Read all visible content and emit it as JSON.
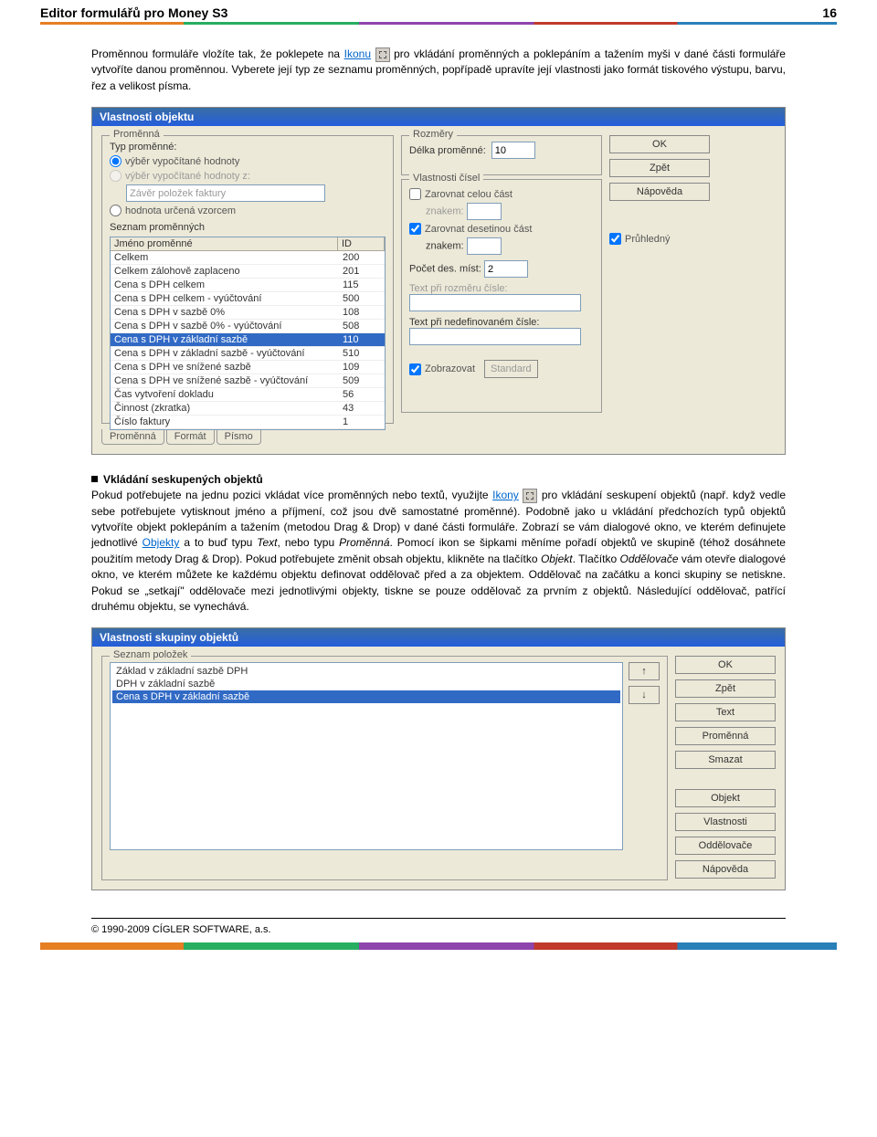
{
  "header": {
    "title": "Editor formulářů pro Money S3",
    "page": "16"
  },
  "para1": {
    "t1": "Proměnnou formuláře vložíte tak, že poklepete na ",
    "link1": "Ikonu",
    "t2": " pro vkládání proměnných a poklepáním a tažením myši v dané části formuláře vytvoříte danou proměnnou. Vyberete její typ ze seznamu proměnných, popřípadě upravíte její vlastnosti jako formát tiskového výstupu, barvu, řez a velikost písma."
  },
  "dlg1": {
    "title": "Vlastnosti objektu",
    "g_promenna": "Proměnná",
    "lbl_typ": "Typ proměnné:",
    "rad1": "výběr vypočítané hodnoty",
    "rad2": "výběr vypočítané hodnoty z:",
    "rad2_val": "Závěr položek faktury",
    "rad3": "hodnota určená vzorcem",
    "lbl_seznam": "Seznam proměnných",
    "th1": "Jméno proměnné",
    "th2": "ID",
    "rows": [
      {
        "n": "Celkem",
        "id": "200"
      },
      {
        "n": "Celkem zálohově zaplaceno",
        "id": "201"
      },
      {
        "n": "Cena s DPH celkem",
        "id": "115"
      },
      {
        "n": "Cena s DPH celkem - vyúčtování",
        "id": "500"
      },
      {
        "n": "Cena s DPH v sazbě 0%",
        "id": "108"
      },
      {
        "n": "Cena s DPH v sazbě 0% - vyúčtování",
        "id": "508"
      },
      {
        "n": "Cena s DPH v základní sazbě",
        "id": "110",
        "sel": true
      },
      {
        "n": "Cena s DPH v základní sazbě - vyúčtování",
        "id": "510"
      },
      {
        "n": "Cena s DPH ve snížené sazbě",
        "id": "109"
      },
      {
        "n": "Cena s DPH ve snížené sazbě - vyúčtování",
        "id": "509"
      },
      {
        "n": "Čas vytvoření dokladu",
        "id": "56"
      },
      {
        "n": "Činnost (zkratka)",
        "id": "43"
      },
      {
        "n": "Číslo faktury",
        "id": "1"
      }
    ],
    "g_rozmery": "Rozměry",
    "lbl_delka": "Délka proměnné:",
    "val_delka": "10",
    "g_vlast": "Vlastnosti čísel",
    "chk_zar": "Zarovnat celou část",
    "lbl_zn1": "znakem:",
    "chk_des": "Zarovnat desetinou část",
    "lbl_zn2": "znakem:",
    "lbl_pdm": "Počet des. míst:",
    "val_pdm": "2",
    "lbl_trez": "Text při rozměru čísle:",
    "lbl_tned": "Text při nedefinovaném čísle:",
    "chk_zob": "Zobrazovat",
    "btn_std": "Standard",
    "btn_ok": "OK",
    "btn_zpet": "Zpět",
    "btn_nap": "Nápověda",
    "chk_pruh": "Průhledný",
    "tab1": "Proměnná",
    "tab2": "Formát",
    "tab3": "Písmo"
  },
  "sec2": {
    "heading": "Vkládání seskupených objektů",
    "t1": "Pokud potřebujete na jednu pozici vkládat více proměnných nebo textů, využijte ",
    "link": "Ikony",
    "t2": " pro vkládání seskupení objektů (např. když vedle sebe potřebujete vytisknout jméno a příjmení, což jsou dvě samostatné proměnné). Podobně jako u vkládání předchozích typů objektů vytvoříte objekt poklepáním a tažením (metodou Drag & Drop) v dané části formuláře. Zobrazí se vám dialogové okno, ve kterém definujete jednotlivé ",
    "link2": "Objekty",
    "t3": " a to buď typu ",
    "em1": "Text",
    "t4": ", nebo typu ",
    "em2": "Proměnná",
    "t5": ". Pomocí ikon se šipkami měníme pořadí objektů ve skupině (téhož dosáhnete použitím metody Drag & Drop). Pokud potřebujete změnit obsah objektu, klikněte na tlačítko ",
    "em3": "Objekt",
    "t6": ". Tlačítko ",
    "em4": "Oddělovače",
    "t7": " vám otevře dialogové okno, ve kterém můžete ke každému objektu definovat oddělovač před a za objektem. Oddělovač na začátku a konci skupiny se netiskne. Pokud se „setkají\" oddělovače mezi jednotlivými objekty, tiskne se pouze oddělovač za prvním z objektů. Následující oddělovač, patřící druhému objektu, se vynechává."
  },
  "dlg2": {
    "title": "Vlastnosti skupiny objektů",
    "g_seznam": "Seznam položek",
    "items": [
      "Základ v základní sazbě DPH",
      "DPH v základní sazbě",
      "Cena s DPH v základní sazbě"
    ],
    "btn_ok": "OK",
    "btn_zpet": "Zpět",
    "btn_text": "Text",
    "btn_prom": "Proměnná",
    "btn_smaz": "Smazat",
    "btn_obj": "Objekt",
    "btn_vlast": "Vlastnosti",
    "btn_odd": "Oddělovače",
    "btn_nap": "Nápověda",
    "up": "↑",
    "down": "↓"
  },
  "footer": "© 1990-2009 CÍGLER SOFTWARE, a.s."
}
